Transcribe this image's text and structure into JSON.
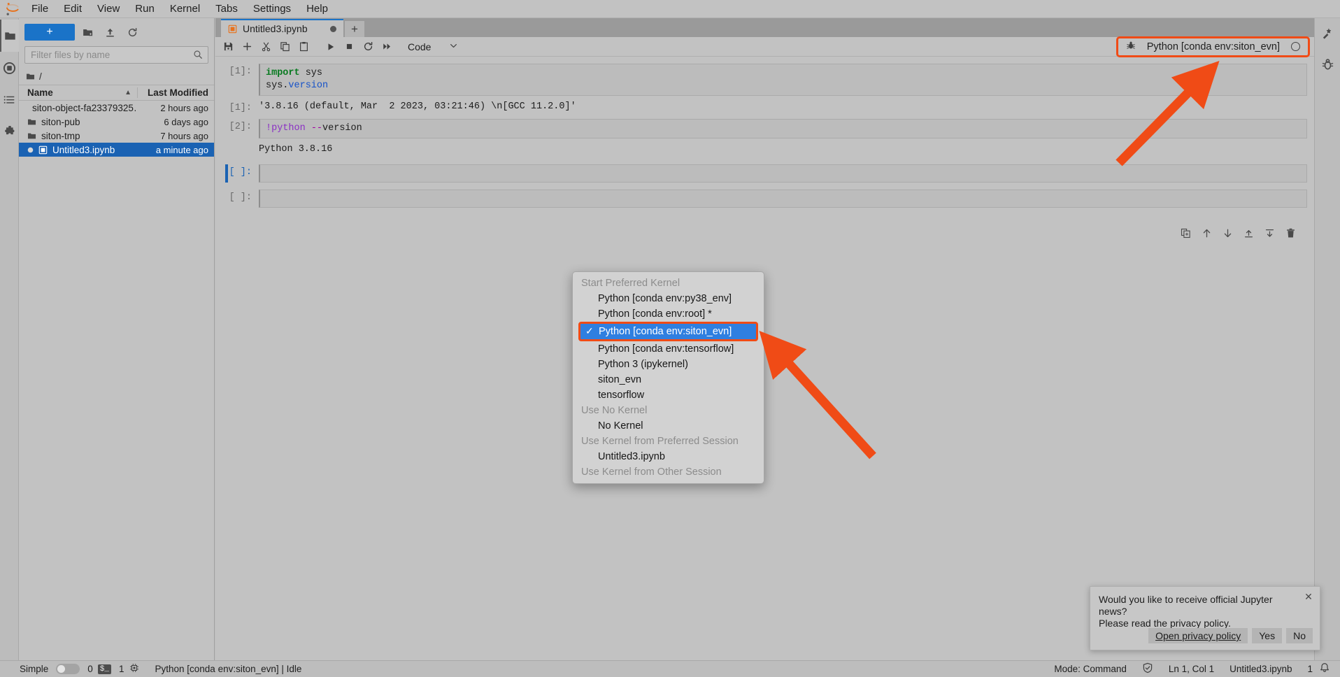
{
  "menubar": {
    "logo": "jupyter-logo",
    "items": [
      "File",
      "Edit",
      "View",
      "Run",
      "Kernel",
      "Tabs",
      "Settings",
      "Help"
    ]
  },
  "left_rail": {
    "items": [
      {
        "name": "file-browser-icon",
        "label": "File Browser"
      },
      {
        "name": "running-terminals-icon",
        "label": "Running Terminals and Kernels"
      },
      {
        "name": "table-of-contents-icon",
        "label": "Table of Contents"
      },
      {
        "name": "extension-manager-icon",
        "label": "Extension Manager"
      }
    ]
  },
  "filebrowser": {
    "new_launcher_label": "+",
    "toolbar_icons": [
      "new-folder-icon",
      "upload-icon",
      "refresh-icon"
    ],
    "filter": {
      "placeholder": "Filter files by name",
      "value": ""
    },
    "breadcrumb": "/",
    "columns": {
      "name": "Name",
      "last_modified": "Last Modified"
    },
    "rows": [
      {
        "icon": "folder-icon",
        "name": "siton-object-fa23379325…",
        "modified": "2 hours ago",
        "selected": false
      },
      {
        "icon": "folder-icon",
        "name": "siton-pub",
        "modified": "6 days ago",
        "selected": false
      },
      {
        "icon": "folder-icon",
        "name": "siton-tmp",
        "modified": "7 hours ago",
        "selected": false
      },
      {
        "icon": "notebook-icon",
        "name": "Untitled3.ipynb",
        "modified": "a minute ago",
        "selected": true
      }
    ]
  },
  "main": {
    "tab": {
      "label": "Untitled3.ipynb",
      "icon": "notebook-icon",
      "dirty": true
    },
    "add_tab_label": "+",
    "toolbar": {
      "buttons": [
        "save-icon",
        "insert-cell-icon",
        "cut-icon",
        "copy-icon",
        "paste-icon",
        "run-icon",
        "stop-icon",
        "restart-icon",
        "restart-run-all-icon"
      ],
      "cell_type": "Code",
      "cell_type_caret": "chevron-down-icon"
    },
    "kernel_indicator": {
      "icon": "kernel-bug-icon",
      "label": "Python [conda env:siton_evn]",
      "status": "idle-circle"
    },
    "cells": [
      {
        "prompt": "[1]:",
        "type": "code",
        "source_tokens": [
          {
            "text": "import",
            "cls": "kw-import"
          },
          {
            "text": " sys\n",
            "cls": ""
          },
          {
            "text": "sys.",
            "cls": ""
          },
          {
            "text": "version",
            "cls": "kw-attr"
          }
        ],
        "source_plain": "import sys\nsys.version"
      },
      {
        "prompt": "[1]:",
        "type": "output",
        "text": "'3.8.16 (default, Mar  2 2023, 03:21:46) \\n[GCC 11.2.0]'"
      },
      {
        "prompt": "[2]:",
        "type": "code",
        "source_tokens": [
          {
            "text": "!python ",
            "cls": "kw-bang"
          },
          {
            "text": "--",
            "cls": "kw-flag"
          },
          {
            "text": "version",
            "cls": ""
          }
        ],
        "source_plain": "!python --version"
      },
      {
        "prompt": "",
        "type": "output",
        "text": "Python 3.8.16"
      },
      {
        "prompt": "[ ]:",
        "type": "code",
        "source_plain": "",
        "active": true
      },
      {
        "prompt": "[ ]:",
        "type": "code",
        "source_plain": "",
        "active": false
      }
    ],
    "cell_tools": [
      "duplicate-cell-icon",
      "move-cell-up-icon",
      "move-cell-down-icon",
      "insert-cell-above-icon",
      "insert-cell-below-icon",
      "delete-cell-icon"
    ]
  },
  "right_rail": {
    "items": [
      {
        "name": "property-inspector-icon"
      },
      {
        "name": "debugger-icon"
      }
    ]
  },
  "kernel_menu": {
    "groups": [
      {
        "title": "Start Preferred Kernel",
        "items": [
          {
            "label": "Python [conda env:py38_env]",
            "selected": false
          },
          {
            "label": "Python [conda env:root] *",
            "selected": false
          },
          {
            "label": "Python [conda env:siton_evn]",
            "selected": true,
            "check": "✓"
          },
          {
            "label": "Python [conda env:tensorflow]",
            "selected": false
          },
          {
            "label": "Python 3 (ipykernel)",
            "selected": false
          },
          {
            "label": "siton_evn",
            "selected": false
          },
          {
            "label": "tensorflow",
            "selected": false
          }
        ]
      },
      {
        "title": "Use No Kernel",
        "items": [
          {
            "label": "No Kernel",
            "selected": false
          }
        ]
      },
      {
        "title": "Use Kernel from Preferred Session",
        "items": [
          {
            "label": "Untitled3.ipynb",
            "selected": false
          }
        ]
      },
      {
        "title": "Use Kernel from Other Session",
        "items": []
      }
    ]
  },
  "toast": {
    "message": "Would you like to receive official Jupyter news?\nPlease read the privacy policy.",
    "close_icon": "close-icon",
    "buttons": [
      {
        "label": "Open privacy policy",
        "style": "link"
      },
      {
        "label": "Yes",
        "style": "normal"
      },
      {
        "label": "No",
        "style": "normal"
      }
    ]
  },
  "statusbar": {
    "simple_label": "Simple",
    "simple_on": false,
    "terminal_count": "0",
    "terminal_icon": "terminal-icon",
    "kernel_count": "1",
    "kernel_icon": "cpu-icon",
    "kernel_status": "Python [conda env:siton_evn] | Idle",
    "mode": "Mode: Command",
    "shield_icon": "shield-check-icon",
    "cursor": "Ln 1, Col 1",
    "filename": "Untitled3.ipynb",
    "notification_count": "1",
    "bell_icon": "bell-icon"
  },
  "colors": {
    "accent_blue": "#1a73c8",
    "selection_blue": "#1a62b3",
    "menu_select_blue": "#2f7fe0",
    "annotation_orange": "#f04b16",
    "chrome_gray": "#c2c2c2",
    "main_bg_gray": "#9a9a9a",
    "code_green": "#087a20",
    "code_blue": "#1652c8",
    "code_purple": "#8a2fc4",
    "code_magenta": "#a100a1"
  }
}
